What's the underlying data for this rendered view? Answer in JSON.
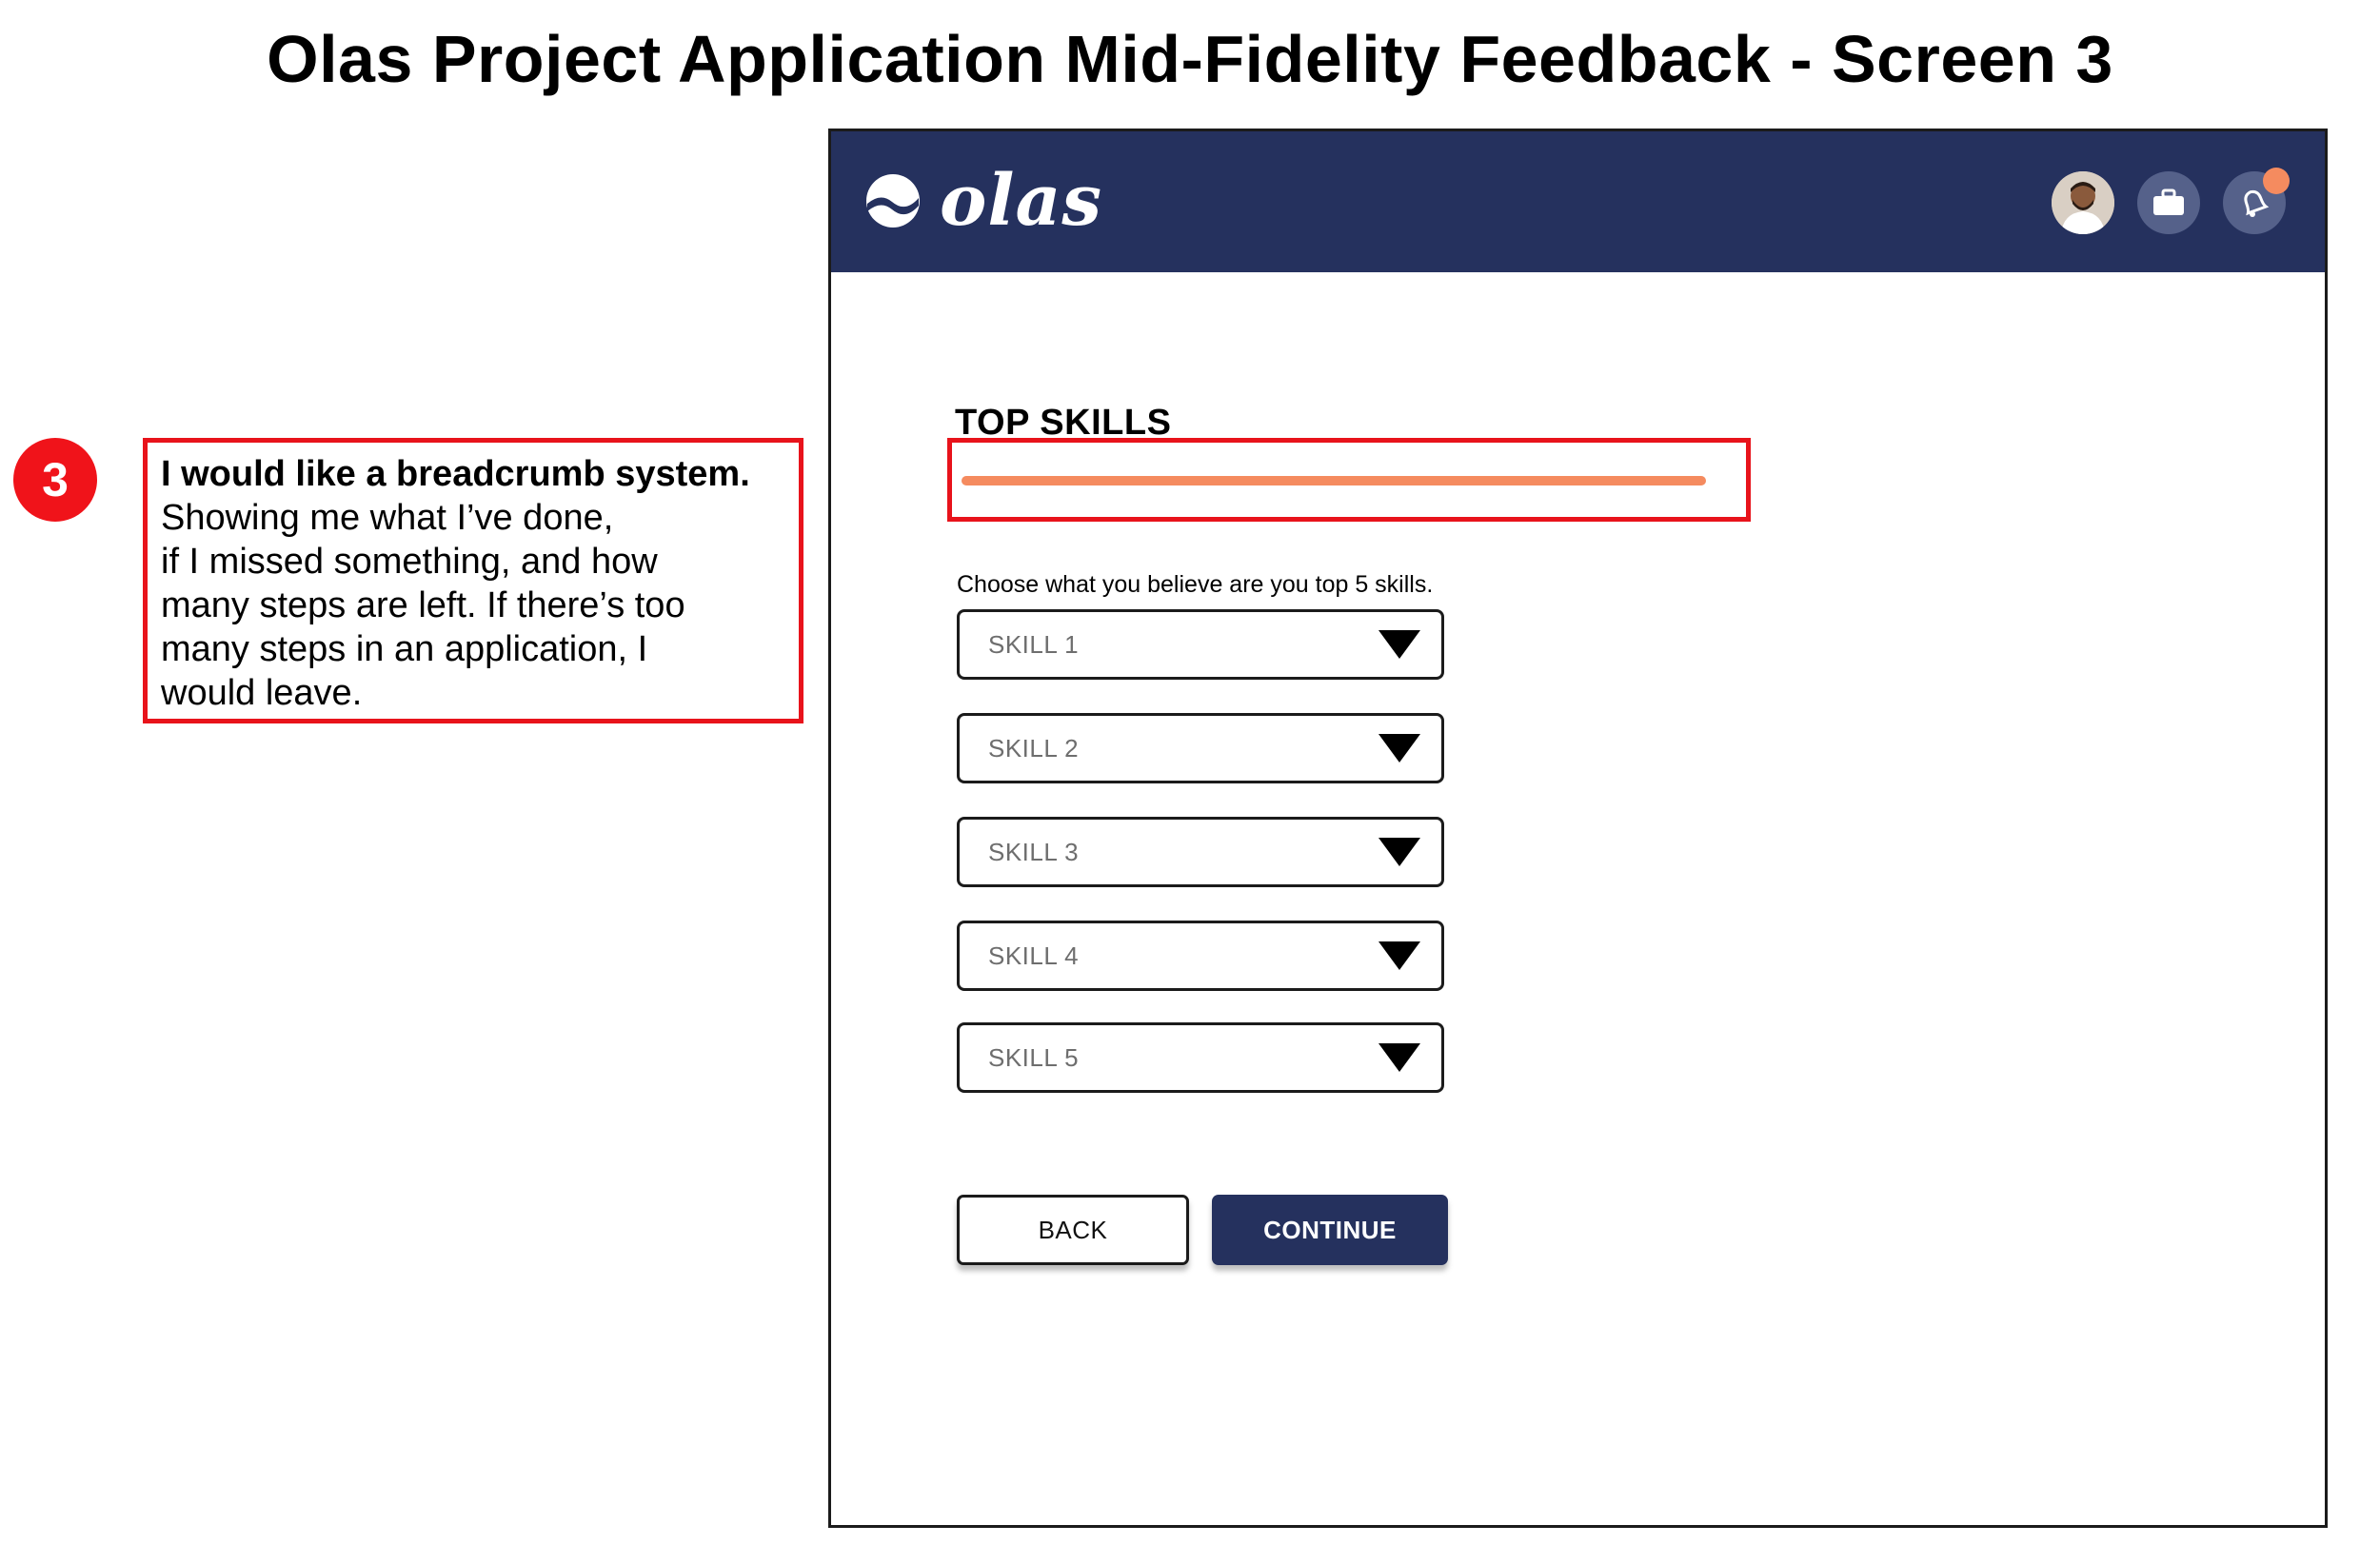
{
  "page_title": "Olas Project Application Mid-Fidelity Feedback - Screen 3",
  "annotation": {
    "number": "3",
    "lead": "I would like a breadcrumb system.",
    "body": "Showing me what I’ve done,\nif I missed something, and how\nmany steps are left. If there’s too\nmany steps in an application, I\nwould leave."
  },
  "app": {
    "logo_text": "olas",
    "header_icons": [
      "avatar",
      "briefcase-icon",
      "bell-icon"
    ],
    "section_title": "TOP SKILLS",
    "progress": 1.0,
    "instruction": "Choose what you believe are you top 5 skills.",
    "skills": [
      {
        "label": "SKILL 1"
      },
      {
        "label": "SKILL 2"
      },
      {
        "label": "SKILL 3"
      },
      {
        "label": "SKILL 4"
      },
      {
        "label": "SKILL 5"
      }
    ],
    "back_label": "BACK",
    "continue_label": "CONTINUE"
  },
  "colors": {
    "header_bg": "#25315e",
    "accent": "#f58b5f",
    "annotation_red": "#e8131b"
  }
}
